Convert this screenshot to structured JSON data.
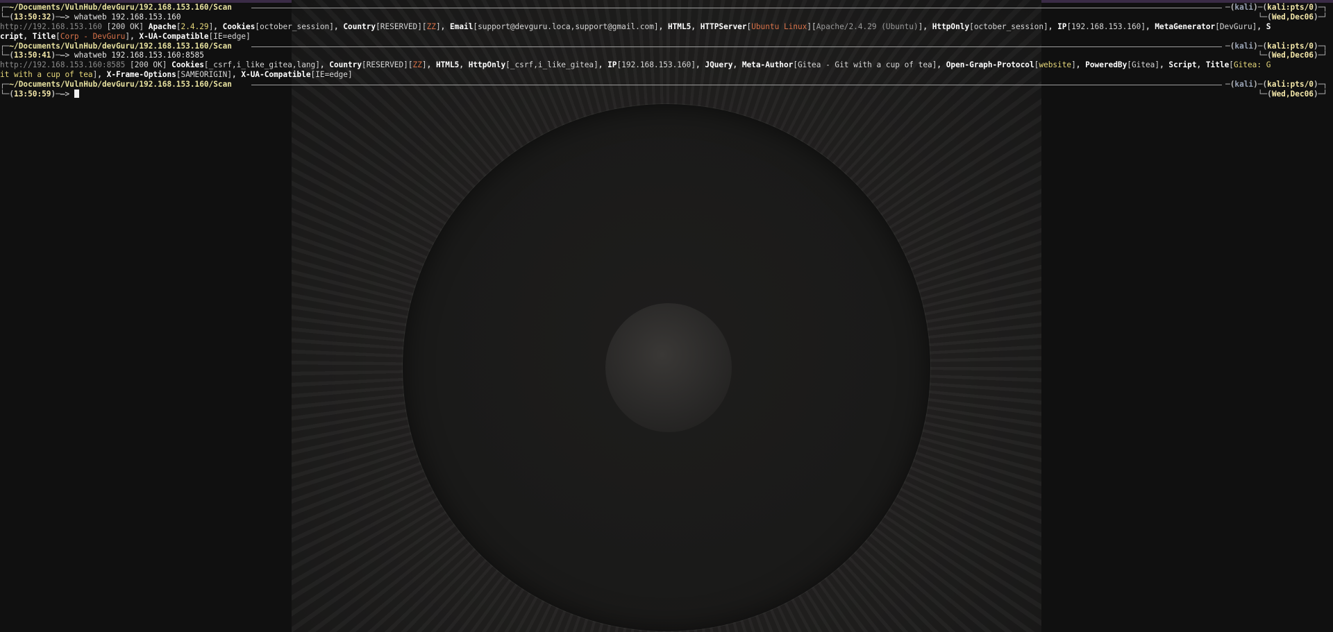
{
  "prompt_path": "~/Documents/VulnHub/devGuru/192.168.153.160/Scan",
  "prompt_host": "kali",
  "prompt_tty": "kali:pts/0",
  "prompt_date": "Wed,Dec06",
  "arrow": "—>",
  "blocks": [
    {
      "time": "13:50:32",
      "command": "whatweb 192.168.153.160"
    },
    {
      "time": "13:50:41",
      "command": "whatweb 192.168.153.160:8585"
    },
    {
      "time": "13:50:59",
      "command": ""
    }
  ],
  "out1": {
    "url": "http://192.168.153.160",
    "status": "[200 OK]",
    "apache": "Apache",
    "apache_v": "2.4.29",
    "cookies": "Cookies",
    "cookies_v": "october_session",
    "country": "Country",
    "country_v": "RESERVED",
    "country_cc": "ZZ",
    "email": "Email",
    "email_v": "support@devguru.loca,support@gmail.com",
    "html5": "HTML5",
    "httpserver": "HTTPServer",
    "httpserver_os": "Ubuntu Linux",
    "httpserver_v": "Apache/2.4.29 (Ubuntu)",
    "httponly": "HttpOnly",
    "httponly_v": "october_session",
    "ip": "IP",
    "ip_v": "192.168.153.160",
    "metagen": "MetaGenerator",
    "metagen_v": "DevGuru",
    "script_head": "S",
    "script_tail": "cript",
    "title": "Title",
    "title_v": "Corp - DevGuru",
    "xua": "X-UA-Compatible",
    "xua_v": "IE=edge"
  },
  "out2": {
    "url": "http://192.168.153.160:8585",
    "status": "[200 OK]",
    "cookies": "Cookies",
    "cookies_v": "_csrf,i_like_gitea,lang",
    "country": "Country",
    "country_v": "RESERVED",
    "country_cc": "ZZ",
    "html5": "HTML5",
    "httponly": "HttpOnly",
    "httponly_v": "_csrf,i_like_gitea",
    "ip": "IP",
    "ip_v": "192.168.153.160",
    "jquery": "JQuery",
    "metaauthor": "Meta-Author",
    "metaauthor_v": "Gitea - Git with a cup of tea",
    "ogp": "Open-Graph-Protocol",
    "ogp_v": "website",
    "poweredby": "PoweredBy",
    "poweredby_v": "Gitea",
    "script": "Script",
    "title": "Title",
    "title_v_head": "Gitea: G",
    "title_v_tail": "it with a cup of tea",
    "xframe": "X-Frame-Options",
    "xframe_v": "SAMEORIGIN",
    "xua": "X-UA-Compatible",
    "xua_v": "IE=edge"
  }
}
